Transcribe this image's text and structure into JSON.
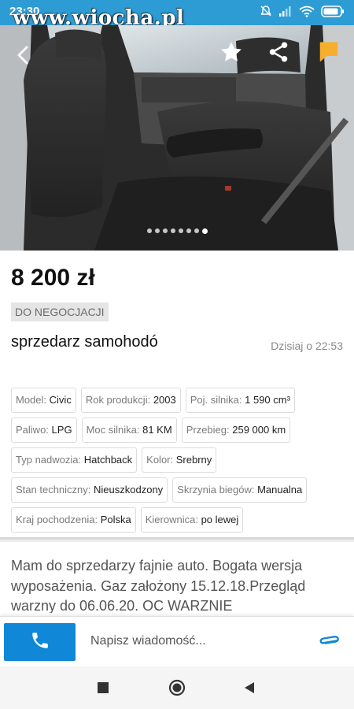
{
  "status_bar": {
    "time": "23:30",
    "battery_icon": "battery-icon",
    "wifi_icon": "wifi-icon",
    "signal_icon": "signal-icon",
    "mute_icon": "bell-off-icon"
  },
  "watermark": "www.wiocha.pl",
  "gallery": {
    "photo_count": 8,
    "active_photo": 8,
    "actions": [
      "star-icon",
      "share-icon",
      "flag-icon"
    ]
  },
  "listing": {
    "price": "8 200 zł",
    "negotiable": "DO NEGOCJACJI",
    "title": "sprzedarz samohodó",
    "date": "Dzisiaj o 22:53"
  },
  "params": [
    {
      "label": "Model:",
      "value": "Civic"
    },
    {
      "label": "Rok produkcji:",
      "value": "2003"
    },
    {
      "label": "Poj. silnika:",
      "value": "1 590 cm³"
    },
    {
      "label": "Paliwo:",
      "value": "LPG"
    },
    {
      "label": "Moc silnika:",
      "value": "81 KM"
    },
    {
      "label": "Przebieg:",
      "value": "259 000 km"
    },
    {
      "label": "Typ nadwozia:",
      "value": "Hatchback"
    },
    {
      "label": "Kolor:",
      "value": "Srebrny"
    },
    {
      "label": "Stan techniczny:",
      "value": "Nieuszkodzony"
    },
    {
      "label": "Skrzynia biegów:",
      "value": "Manualna"
    },
    {
      "label": "Kraj pochodzenia:",
      "value": "Polska"
    },
    {
      "label": "Kierownica:",
      "value": "po lewej"
    }
  ],
  "description": "Mam do sprzedarzy fajnie auto. Bogata wersja wyposażenia. Gaz założony 15.12.18.Przegląd warzny do 06.06.20. OC WARZNIE",
  "contact": {
    "message_placeholder": "Napisz wiadomość...",
    "call_icon": "phone-icon",
    "attach_icon": "paperclip-icon"
  },
  "colors": {
    "status_bar": "#2e9cd4",
    "call_button": "#1187d8",
    "flag": "#f6ae2d",
    "attach": "#1187d8"
  }
}
